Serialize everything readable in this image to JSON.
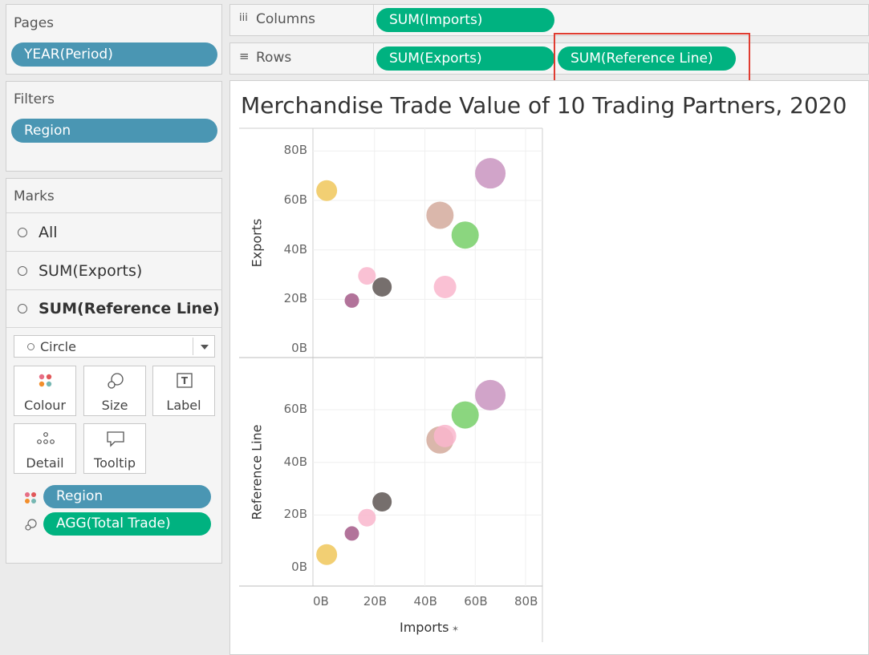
{
  "pages": {
    "title": "Pages",
    "pill": "YEAR(Period)"
  },
  "filters": {
    "title": "Filters",
    "pill": "Region"
  },
  "marks": {
    "title": "Marks",
    "rows": [
      "All",
      "SUM(Exports)",
      "SUM(Reference Line)"
    ],
    "mark_type": "Circle",
    "cards": [
      "Colour",
      "Size",
      "Label",
      "Detail",
      "Tooltip"
    ],
    "fields": [
      {
        "icon": "colour-icon",
        "label": "Region",
        "color": "blue"
      },
      {
        "icon": "size-icon",
        "label": "AGG(Total Trade)",
        "color": "green"
      }
    ]
  },
  "columns": {
    "label": "Columns",
    "pills": [
      "SUM(Imports)"
    ]
  },
  "rows": {
    "label": "Rows",
    "pills": [
      "SUM(Exports)",
      "SUM(Reference Line)"
    ]
  },
  "highlight_color": "#e03c31",
  "chart_data": {
    "type": "scatter",
    "title": "Merchandise Trade Value of 10 Trading Partners, 2020",
    "xlabel": "Imports",
    "xlim": [
      0,
      80
    ],
    "x_ticks": [
      "0B",
      "20B",
      "40B",
      "60B",
      "80B"
    ],
    "grid": true,
    "panes": [
      {
        "ylabel": "Exports",
        "ylim": [
          0,
          85
        ],
        "y_ticks": [
          "0B",
          "20B",
          "40B",
          "60B",
          "80B"
        ],
        "points": [
          {
            "x": 1,
            "y": 64,
            "r": 13,
            "color": "#f0c75a"
          },
          {
            "x": 66,
            "y": 71,
            "r": 19,
            "color": "#c994c0"
          },
          {
            "x": 46,
            "y": 54,
            "r": 17,
            "color": "#d4aa9c"
          },
          {
            "x": 56,
            "y": 46,
            "r": 17,
            "color": "#77cf69"
          },
          {
            "x": 17,
            "y": 29.5,
            "r": 11,
            "color": "#f9b6cd"
          },
          {
            "x": 23,
            "y": 25,
            "r": 12,
            "color": "#5e5654"
          },
          {
            "x": 48,
            "y": 25,
            "r": 14,
            "color": "#f9b6cd"
          },
          {
            "x": 11,
            "y": 19.5,
            "r": 9,
            "color": "#a55a88"
          }
        ]
      },
      {
        "ylabel": "Reference Line",
        "ylim": [
          -3,
          74
        ],
        "y_ticks": [
          "0B",
          "20B",
          "40B",
          "60B"
        ],
        "points": [
          {
            "x": 66,
            "y": 65.5,
            "r": 19,
            "color": "#c994c0"
          },
          {
            "x": 56,
            "y": 58,
            "r": 17,
            "color": "#77cf69"
          },
          {
            "x": 46,
            "y": 48.5,
            "r": 17,
            "color": "#d4aa9c"
          },
          {
            "x": 48,
            "y": 50,
            "r": 14,
            "color": "#f9b6cd"
          },
          {
            "x": 23,
            "y": 25,
            "r": 12,
            "color": "#5e5654"
          },
          {
            "x": 17,
            "y": 19,
            "r": 11,
            "color": "#f9b6cd"
          },
          {
            "x": 11,
            "y": 13,
            "r": 9,
            "color": "#a55a88"
          },
          {
            "x": 1,
            "y": 5,
            "r": 13,
            "color": "#f0c75a"
          }
        ]
      }
    ]
  }
}
